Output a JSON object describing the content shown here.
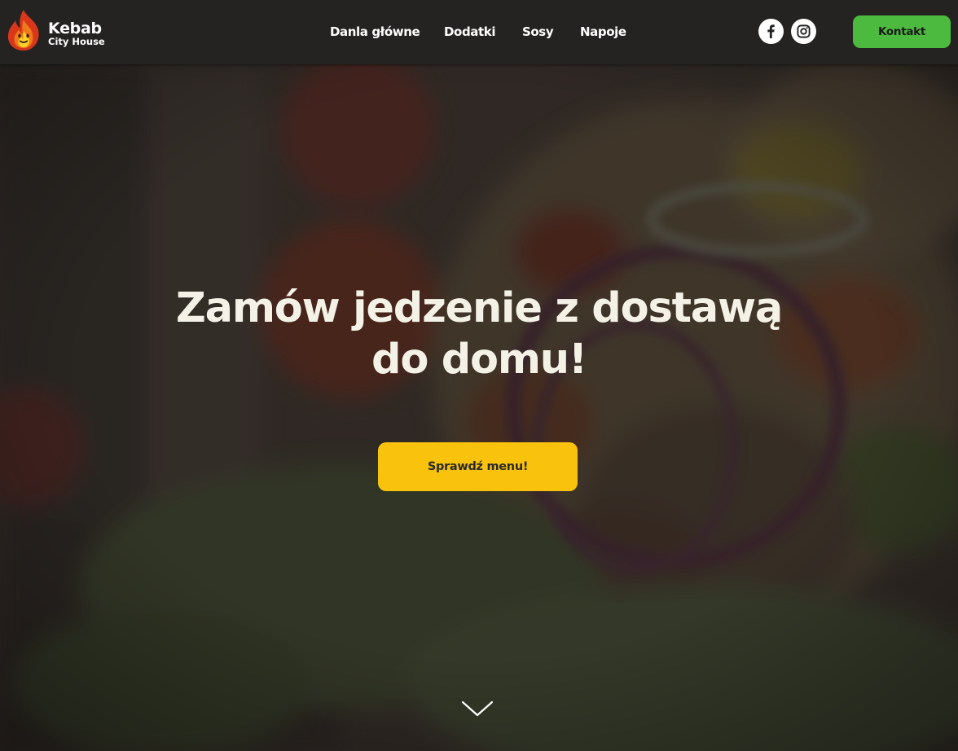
{
  "brand": {
    "title": "Kebab",
    "subtitle": "City House",
    "icon": "flame-icon"
  },
  "nav": {
    "items": [
      {
        "label": "Danla główne"
      },
      {
        "label": "Dodatki"
      },
      {
        "label": "Sosy"
      },
      {
        "label": "Napoje"
      }
    ]
  },
  "social": {
    "facebook_icon": "facebook-icon",
    "instagram_icon": "instagram-icon"
  },
  "header": {
    "contact_label": "Kontakt"
  },
  "hero": {
    "title_line1": "Zamów jedzenie z dostawą",
    "title_line2": "do domu!",
    "cta_label": "Sprawdź menu!",
    "scroll_icon": "chevron-down-icon"
  },
  "colors": {
    "header_bg": "#242322",
    "accent_green": "#4cba3f",
    "accent_yellow": "#f9c30d",
    "hero_text": "#f4f2e6"
  }
}
